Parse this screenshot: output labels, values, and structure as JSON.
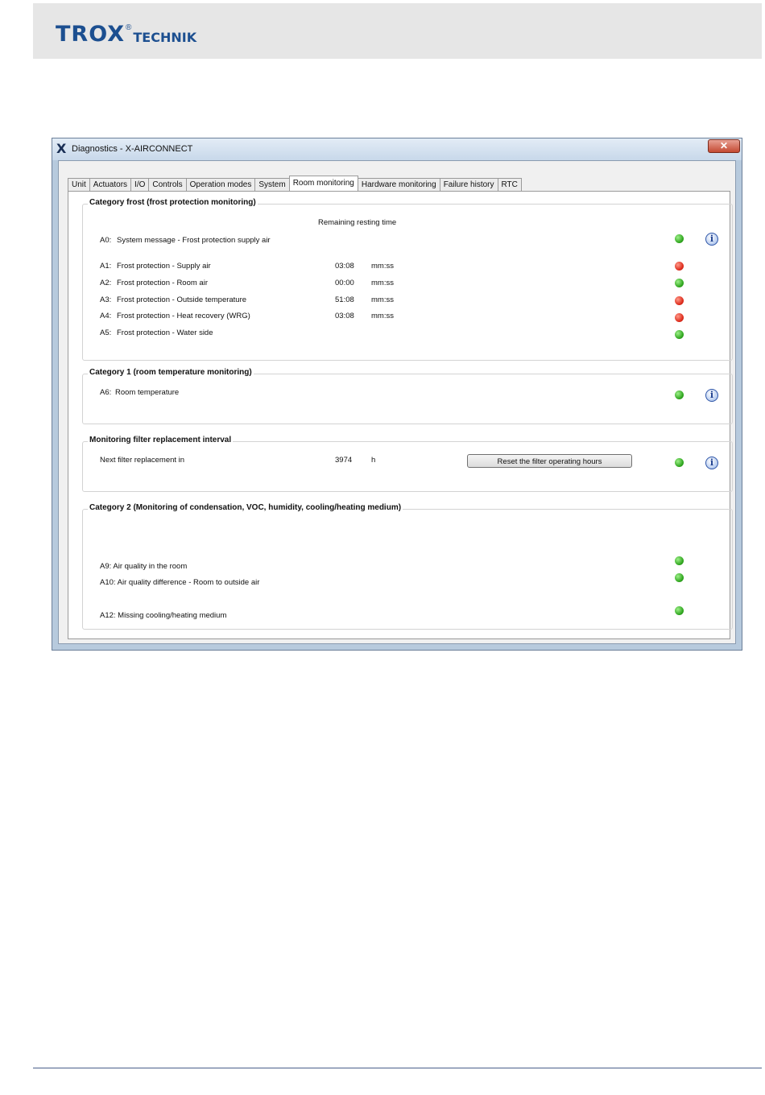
{
  "page": {
    "logo_main": "TROX",
    "logo_reg": "®",
    "logo_sub": "TECHNIK"
  },
  "window": {
    "icon": "X",
    "title": "Diagnostics - X-AIRCONNECT",
    "close_label": "✕"
  },
  "tabs": [
    {
      "label": "Unit"
    },
    {
      "label": "Actuators"
    },
    {
      "label": "I/O"
    },
    {
      "label": "Controls"
    },
    {
      "label": "Operation modes"
    },
    {
      "label": "System"
    },
    {
      "label": "Room monitoring",
      "active": true
    },
    {
      "label": "Hardware monitoring"
    },
    {
      "label": "Failure history"
    },
    {
      "label": "RTC"
    }
  ],
  "frost": {
    "title": "Category frost (frost protection monitoring)",
    "column_header": "Remaining resting time",
    "rows": [
      {
        "code": "A0:",
        "label": "System message - Frost protection supply air",
        "value": "",
        "unit": "",
        "status": "green"
      },
      {
        "code": "A1:",
        "label": "Frost protection - Supply air",
        "value": "03:08",
        "unit": "mm:ss",
        "status": "red"
      },
      {
        "code": "A2:",
        "label": "Frost protection - Room air",
        "value": "00:00",
        "unit": "mm:ss",
        "status": "green"
      },
      {
        "code": "A3:",
        "label": "Frost protection - Outside temperature",
        "value": "51:08",
        "unit": "mm:ss",
        "status": "red"
      },
      {
        "code": "A4:",
        "label": "Frost protection - Heat recovery (WRG)",
        "value": "03:08",
        "unit": "mm:ss",
        "status": "red"
      },
      {
        "code": "A5:",
        "label": "Frost protection - Water side",
        "value": "",
        "unit": "",
        "status": "green"
      }
    ]
  },
  "cat1": {
    "title": "Category 1 (room temperature monitoring)",
    "row": {
      "code": "A6:",
      "label": "Room temperature",
      "status": "green"
    }
  },
  "filter": {
    "title": "Monitoring filter replacement interval",
    "label": "Next filter replacement in",
    "value": "3974",
    "unit": "h",
    "reset_label": "Reset the filter operating hours",
    "status": "green"
  },
  "cat2": {
    "title": "Category 2 (Monitoring of condensation, VOC, humidity, cooling/heating medium)",
    "rows": [
      {
        "label": "A9:  Air quality in the room",
        "status": "green"
      },
      {
        "label": "A10: Air quality difference - Room to outside air",
        "status": "green"
      },
      {
        "label": "A12: Missing cooling/heating medium",
        "status": "green"
      }
    ]
  },
  "info_glyph": "i",
  "colors": {
    "brand": "#1c4f90",
    "led_green": "#2fa51e",
    "led_red": "#dd2b1b"
  }
}
